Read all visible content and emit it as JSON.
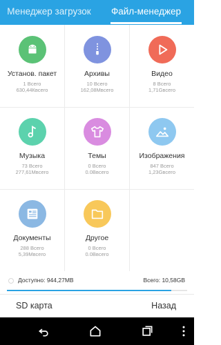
{
  "tabs": [
    {
      "label": "Менеджер загрузок"
    },
    {
      "label": "Файл-менеджер"
    }
  ],
  "categories": [
    {
      "label": "Установ. пакет",
      "count": "1 Всего",
      "size": "630,44Квсего",
      "color": "#5bc276",
      "icon": "android-icon"
    },
    {
      "label": "Архивы",
      "count": "10 Всего",
      "size": "162,08Мвсего",
      "color": "#7f93df",
      "icon": "archive-zip-icon"
    },
    {
      "label": "Видео",
      "count": "8 Всего",
      "size": "1,71Gвсего",
      "color": "#f06b58",
      "icon": "play-icon"
    },
    {
      "label": "Музыка",
      "count": "73 Всего",
      "size": "277,61Мвсего",
      "color": "#5cd2ad",
      "icon": "music-note-icon"
    },
    {
      "label": "Темы",
      "count": "0 Всего",
      "size": "0.0Bвсего",
      "color": "#d98ce0",
      "icon": "tshirt-icon"
    },
    {
      "label": "Изображения",
      "count": "847 Всего",
      "size": "1,23Gвсего",
      "color": "#8ec8f0",
      "icon": "image-icon"
    },
    {
      "label": "Документы",
      "count": "288 Всего",
      "size": "5,39Мвсего",
      "color": "#8bb8e3",
      "icon": "document-icon"
    },
    {
      "label": "Другое",
      "count": "0 Всего",
      "size": "0.0Bвсего",
      "color": "#f8c85a",
      "icon": "folder-icon"
    }
  ],
  "storage": {
    "available": "Доступно: 944,27MB",
    "total": "Всего: 10,58GB",
    "used_fraction": 0.91
  },
  "bottom": {
    "sd_label": "SD карта",
    "back_label": "Назад"
  },
  "nav_icons": [
    "back-icon",
    "home-icon",
    "recents-icon",
    "menu-dots-icon"
  ],
  "colors": {
    "accent": "#2aa3e3"
  }
}
